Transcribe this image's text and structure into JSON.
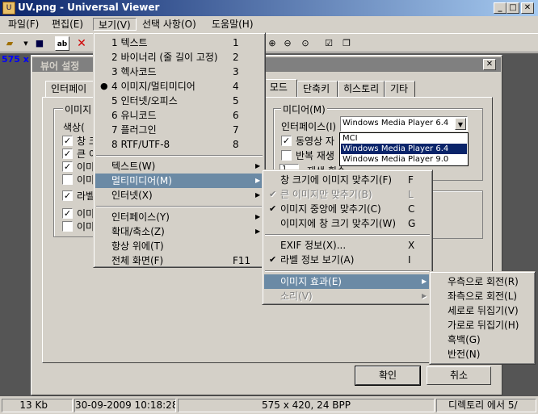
{
  "window": {
    "title": "UV.png - Universal Viewer"
  },
  "menubar": [
    {
      "label": "파일(F)"
    },
    {
      "label": "편집(E)"
    },
    {
      "label": "보기(V)"
    },
    {
      "label": "선택 사항(O)"
    },
    {
      "label": "도움말(H)"
    }
  ],
  "image_info": "575 x 420",
  "view_menu": {
    "items": [
      {
        "label": "1 텍스트",
        "key": "1"
      },
      {
        "label": "2 바이너리 (줄 길이 고정)",
        "key": "2"
      },
      {
        "label": "3 헥사코드",
        "key": "3"
      },
      {
        "label": "4 이미지/멀티미디어",
        "key": "4",
        "checked": true
      },
      {
        "label": "5 인터넷/오피스",
        "key": "5"
      },
      {
        "label": "6 유니코드",
        "key": "6"
      },
      {
        "label": "7 플러그인",
        "key": "7"
      },
      {
        "label": "8 RTF/UTF-8",
        "key": "8"
      },
      {
        "label": "텍스트(W)",
        "submenu": true
      },
      {
        "label": "멀티미디어(M)",
        "submenu": true,
        "highlighted": true
      },
      {
        "label": "인터넷(X)",
        "submenu": true
      },
      {
        "label": "인터페이스(Y)",
        "submenu": true
      },
      {
        "label": "확대/축소(Z)",
        "submenu": true
      },
      {
        "label": "항상 위에(T)"
      },
      {
        "label": "전체 화면(F)",
        "key": "F11"
      }
    ]
  },
  "multimedia_menu": {
    "items": [
      {
        "label": "창 크기에 이미지 맞추기(F)",
        "key": "F"
      },
      {
        "label": "큰 이미지만 맞추기(B)",
        "key": "L",
        "disabled": true,
        "checked": true
      },
      {
        "label": "이미지 중앙에 맞추기(C)",
        "key": "C",
        "checked": true
      },
      {
        "label": "이미지에 창 크기 맞추기(W)",
        "key": "G"
      },
      {
        "label": "EXIF 정보(X)...",
        "key": "X"
      },
      {
        "label": "라벨 정보 보기(A)",
        "key": "I",
        "checked": true
      },
      {
        "label": "이미지 효과(E)",
        "submenu": true,
        "highlighted": true
      },
      {
        "label": "소리(V)",
        "submenu": true,
        "disabled": true
      }
    ]
  },
  "effects_menu": {
    "items": [
      {
        "label": "우측으로 회전(R)"
      },
      {
        "label": "좌측으로 회전(L)"
      },
      {
        "label": "세로로 뒤집기(V)"
      },
      {
        "label": "가로로 뒤집기(H)"
      },
      {
        "label": "흑백(G)"
      },
      {
        "label": "반전(N)"
      }
    ]
  },
  "dialog": {
    "title": "뷰어 설정",
    "tabs": [
      "인터페이",
      "어 모드",
      "단축키",
      "히스토리",
      "기타"
    ],
    "left_group": {
      "title": "이미지",
      "color_label": "색상(",
      "checkboxes": [
        {
          "label": "창 크",
          "checked": true
        },
        {
          "label": "큰 이",
          "checked": true
        },
        {
          "label": "이미",
          "checked": true
        },
        {
          "label": "이미",
          "checked": false
        },
        {
          "label": "라벨",
          "checked": true
        },
        {
          "label": "이미",
          "checked": true
        },
        {
          "label": "이미",
          "checked": false
        }
      ]
    },
    "media_group": {
      "title": "미디어(M)",
      "interface_label": "인터페이스(I)",
      "interface_value": "Windows Media Player 6.4",
      "options": [
        "MCI",
        "Windows Media Player 6.4",
        "Windows Media Player 9.0"
      ],
      "selected_index": 1,
      "checkboxes": [
        {
          "label": "동영상 자",
          "checked": true
        },
        {
          "label": "반복 재생",
          "checked": false
        }
      ],
      "repeat_value": "1",
      "repeat_label": "재생 횟수"
    },
    "ok_label": "확인",
    "cancel_label": "취소"
  },
  "statusbar": {
    "size": "13 Kb",
    "date": "30-09-2009 10:18:28",
    "dims": "575 x 420, 24 BPP",
    "position": "디렉토리 에서 5/"
  }
}
